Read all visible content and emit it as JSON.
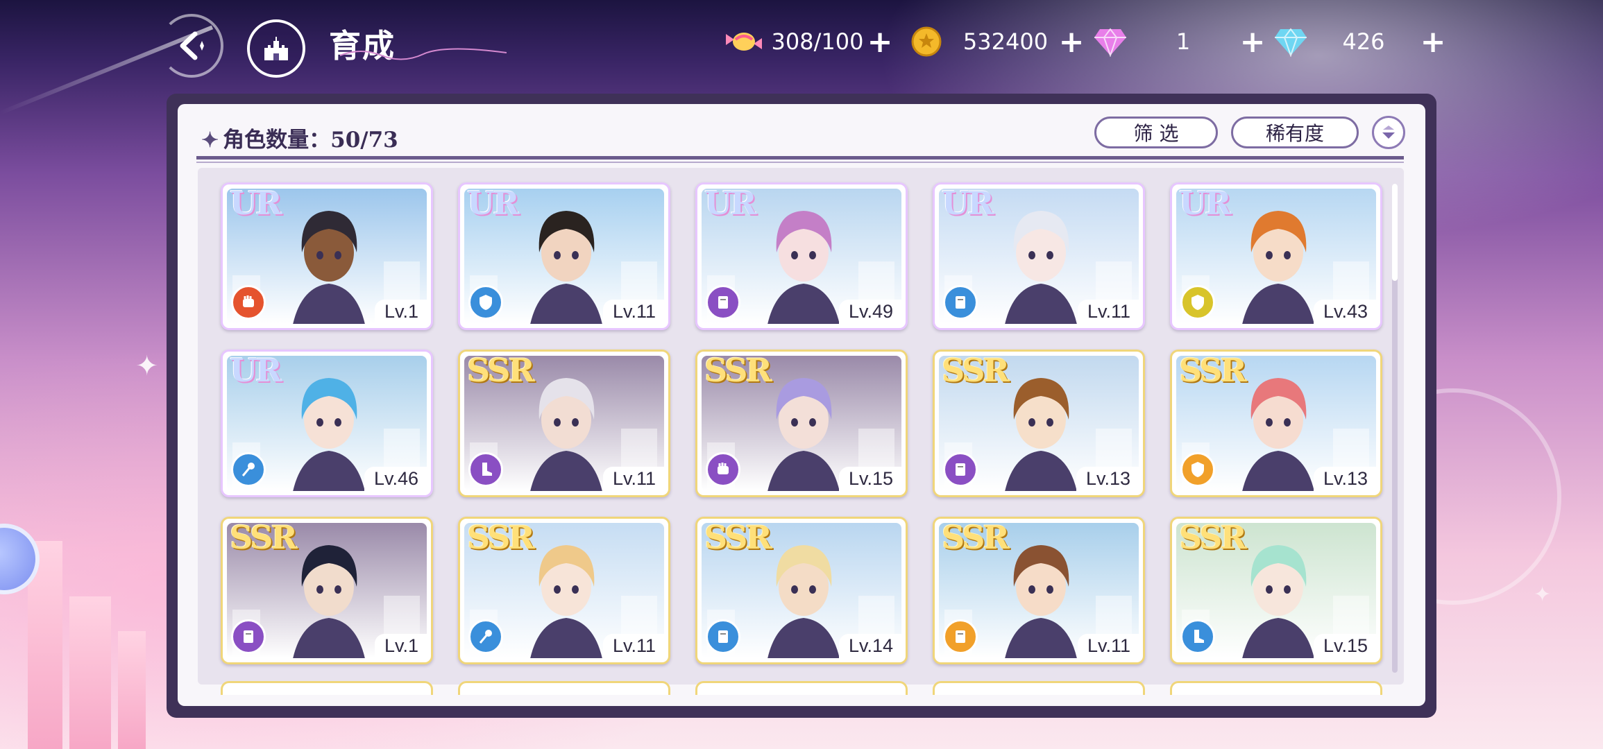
{
  "header": {
    "title": "育成",
    "back_icon": "back-arrow-icon",
    "home_icon": "castle-icon"
  },
  "resources": [
    {
      "name": "candy",
      "icon": "candy-icon",
      "value": "308/100"
    },
    {
      "name": "coin",
      "icon": "gold-coin-icon",
      "value": "532400"
    },
    {
      "name": "pink-gem",
      "icon": "pink-diamond-icon",
      "value": "1"
    },
    {
      "name": "blue-gem",
      "icon": "blue-diamond-icon",
      "value": "426"
    }
  ],
  "panel": {
    "count_label": "角色数量：50/73",
    "filter_label": "筛 选",
    "rarity_label": "稀有度"
  },
  "colors": {
    "accent": "#6b5b8c",
    "ur_frame": "#e7c6ff",
    "ssr_frame": "#f0d67a"
  },
  "cards": [
    {
      "rarity": "UR",
      "level": "Lv.1",
      "role": "fist",
      "role_color": "#e5532e",
      "hair": "#2f2a35",
      "skin": "#8a5a3a",
      "sky": "#9cc6ec"
    },
    {
      "rarity": "UR",
      "level": "Lv.11",
      "role": "shield",
      "role_color": "#3a8fdb",
      "hair": "#2a2320",
      "skin": "#f1d4c0",
      "sky": "#a7d0f0"
    },
    {
      "rarity": "UR",
      "level": "Lv.49",
      "role": "book",
      "role_color": "#8a4fc3",
      "hair": "#c47fc7",
      "skin": "#f6dfe0",
      "sky": "#b9d6f0"
    },
    {
      "rarity": "UR",
      "level": "Lv.11",
      "role": "book",
      "role_color": "#3a8fdb",
      "hair": "#e6e9f2",
      "skin": "#f7e7e4",
      "sky": "#c5dbf3"
    },
    {
      "rarity": "UR",
      "level": "Lv.43",
      "role": "shield",
      "role_color": "#d8c42a",
      "hair": "#e07a2f",
      "skin": "#f6dcc8",
      "sky": "#b7d7f2"
    },
    {
      "rarity": "UR",
      "level": "Lv.46",
      "role": "staff",
      "role_color": "#3a8fdb",
      "hair": "#4fb1e6",
      "skin": "#f6e1d6",
      "sky": "#a8cfeb"
    },
    {
      "rarity": "SSR",
      "level": "Lv.11",
      "role": "boot",
      "role_color": "#8a4fc3",
      "hair": "#e5e2ea",
      "skin": "#f2ddd3",
      "sky": "#9a8aa9"
    },
    {
      "rarity": "SSR",
      "level": "Lv.15",
      "role": "fist",
      "role_color": "#8a4fc3",
      "hair": "#a99be0",
      "skin": "#f3dfd8",
      "sky": "#9a8aa9"
    },
    {
      "rarity": "SSR",
      "level": "Lv.13",
      "role": "book",
      "role_color": "#8a4fc3",
      "hair": "#9b5e2c",
      "skin": "#f6dfca",
      "sky": "#c2d9ef"
    },
    {
      "rarity": "SSR",
      "level": "Lv.13",
      "role": "shield",
      "role_color": "#f1a02a",
      "hair": "#e8787b",
      "skin": "#f6dcd0",
      "sky": "#b7d7f2"
    },
    {
      "rarity": "SSR",
      "level": "Lv.1",
      "role": "book",
      "role_color": "#8a4fc3",
      "hair": "#1f2238",
      "skin": "#f1dccc",
      "sky": "#9a8aa9"
    },
    {
      "rarity": "SSR",
      "level": "Lv.11",
      "role": "staff",
      "role_color": "#3a8fdb",
      "hair": "#efc98a",
      "skin": "#f7e4d8",
      "sky": "#c6ddf3"
    },
    {
      "rarity": "SSR",
      "level": "Lv.14",
      "role": "book",
      "role_color": "#3a8fdb",
      "hair": "#f0dca2",
      "skin": "#f4dcc6",
      "sky": "#b9d6f0"
    },
    {
      "rarity": "SSR",
      "level": "Lv.11",
      "role": "book",
      "role_color": "#f1a02a",
      "hair": "#8a5232",
      "skin": "#f6dcc8",
      "sky": "#a8cfeb"
    },
    {
      "rarity": "SSR",
      "level": "Lv.15",
      "role": "boot",
      "role_color": "#3a8fdb",
      "hair": "#a6e3cf",
      "skin": "#f7e6dc",
      "sky": "#cde4d0"
    }
  ]
}
